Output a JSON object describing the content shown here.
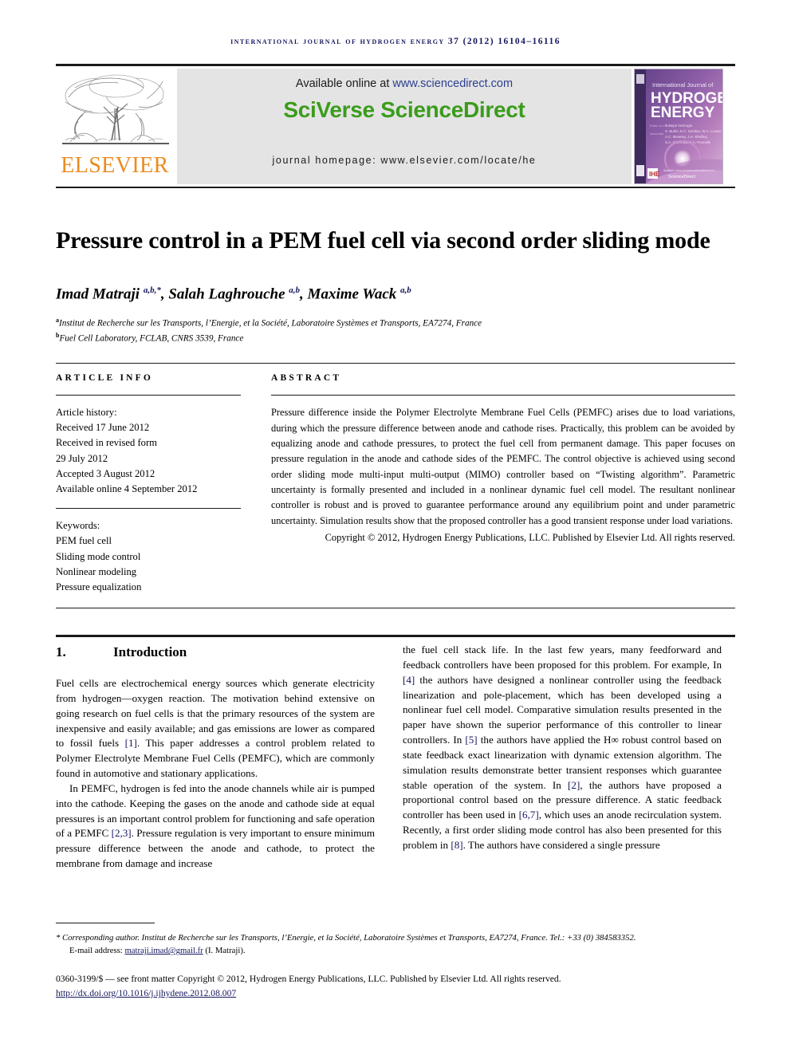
{
  "running_head": "International Journal of Hydrogen Energy 37 (2012) 16104–16116",
  "masthead": {
    "publisher_name": "ELSEVIER",
    "available_prefix": "Available online at ",
    "available_url": "www.sciencedirect.com",
    "brand_sci": "SciVerse ",
    "brand_direct": "ScienceDirect",
    "journal_homepage": "journal homepage: www.elsevier.com/locate/he",
    "cover": {
      "line1": "International Journal of",
      "line2": "HYDROGEN",
      "line3": "ENERGY",
      "footer": "ScienceDirect"
    },
    "colors": {
      "elsevier_orange": "#ec8b1f",
      "sciencedirect_green": "#3a9c1b",
      "link_blue": "#2a3f8f",
      "panel_grey": "#e4e4e4",
      "runhead_navy": "#15175e"
    }
  },
  "article": {
    "title": "Pressure control in a PEM fuel cell via second order sliding mode",
    "authors_html": "Imad Matraji <sup>a,b,*</sup>, Salah Laghrouche <sup>a,b</sup>, Maxime Wack <sup>a,b</sup>",
    "affiliation_a": "Institut de Recherche sur les Transports, l’Energie, et la Société, Laboratoire Systèmes et Transports, EA7274, France",
    "affiliation_b": "Fuel Cell Laboratory, FCLAB, CNRS 3539, France"
  },
  "article_info": {
    "heading": "ARTICLE INFO",
    "history_label": "Article history:",
    "history": [
      "Received 17 June 2012",
      "Received in revised form",
      "29 July 2012",
      "Accepted 3 August 2012",
      "Available online 4 September 2012"
    ],
    "keywords_label": "Keywords:",
    "keywords": [
      "PEM fuel cell",
      "Sliding mode control",
      "Nonlinear modeling",
      "Pressure equalization"
    ]
  },
  "abstract": {
    "heading": "ABSTRACT",
    "text": "Pressure difference inside the Polymer Electrolyte Membrane Fuel Cells (PEMFC) arises due to load variations, during which the pressure difference between anode and cathode rises. Practically, this problem can be avoided by equalizing anode and cathode pressures, to protect the fuel cell from permanent damage. This paper focuses on pressure regulation in the anode and cathode sides of the PEMFC. The control objective is achieved using second order sliding mode multi-input multi-output (MIMO) controller based on “Twisting algorithm”. Parametric uncertainty is formally presented and included in a nonlinear dynamic fuel cell model. The resultant nonlinear controller is robust and is proved to guarantee performance around any equilibrium point and under parametric uncertainty. Simulation results show that the proposed controller has a good transient response under load variations.",
    "copyright": "Copyright © 2012, Hydrogen Energy Publications, LLC. Published by Elsevier Ltd. All rights reserved."
  },
  "body": {
    "section_number": "1.",
    "section_title": "Introduction",
    "left_column": [
      "Fuel cells are electrochemical energy sources which generate electricity from hydrogen—oxygen reaction. The motivation behind extensive on going research on fuel cells is that the primary resources of the system are inexpensive and easily available; and gas emissions are lower as compared to fossil fuels [1]. This paper addresses a control problem related to Polymer Electrolyte Membrane Fuel Cells (PEMFC), which are commonly found in automotive and stationary applications.",
      "In PEMFC, hydrogen is fed into the anode channels while air is pumped into the cathode. Keeping the gases on the anode and cathode side at equal pressures is an important control problem for functioning and safe operation of a PEMFC [2,3]. Pressure regulation is very important to ensure minimum pressure difference between the anode and cathode, to protect the membrane from damage and increase"
    ],
    "right_column": [
      "the fuel cell stack life. In the last few years, many feedforward and feedback controllers have been proposed for this problem. For example, In [4] the authors have designed a nonlinear controller using the feedback linearization and pole-placement, which has been developed using a nonlinear fuel cell model. Comparative simulation results presented in the paper have shown the superior performance of this controller to linear controllers. In [5] the authors have applied the H∞ robust control based on state feedback exact linearization with dynamic extension algorithm. The simulation results demonstrate better transient responses which guarantee stable operation of the system. In [2], the authors have proposed a proportional control based on the pressure difference. A static feedback controller has been used in [6,7], which uses an anode recirculation system. Recently, a first order sliding mode control has also been presented for this problem in [8]. The authors have considered a single pressure"
    ]
  },
  "footer": {
    "corresponding": "* Corresponding author. Institut de Recherche sur les Transports, l’Energie, et la Société, Laboratoire Systèmes et Transports, EA7274, France. Tel.: +33 (0) 384583352.",
    "email_label": "E-mail address: ",
    "email": "matraji.imad@gmail.fr",
    "email_suffix": " (I. Matraji).",
    "front_matter": "0360-3199/$ — see front matter Copyright © 2012, Hydrogen Energy Publications, LLC. Published by Elsevier Ltd. All rights reserved.",
    "doi": "http://dx.doi.org/10.1016/j.ijhydene.2012.08.007"
  }
}
